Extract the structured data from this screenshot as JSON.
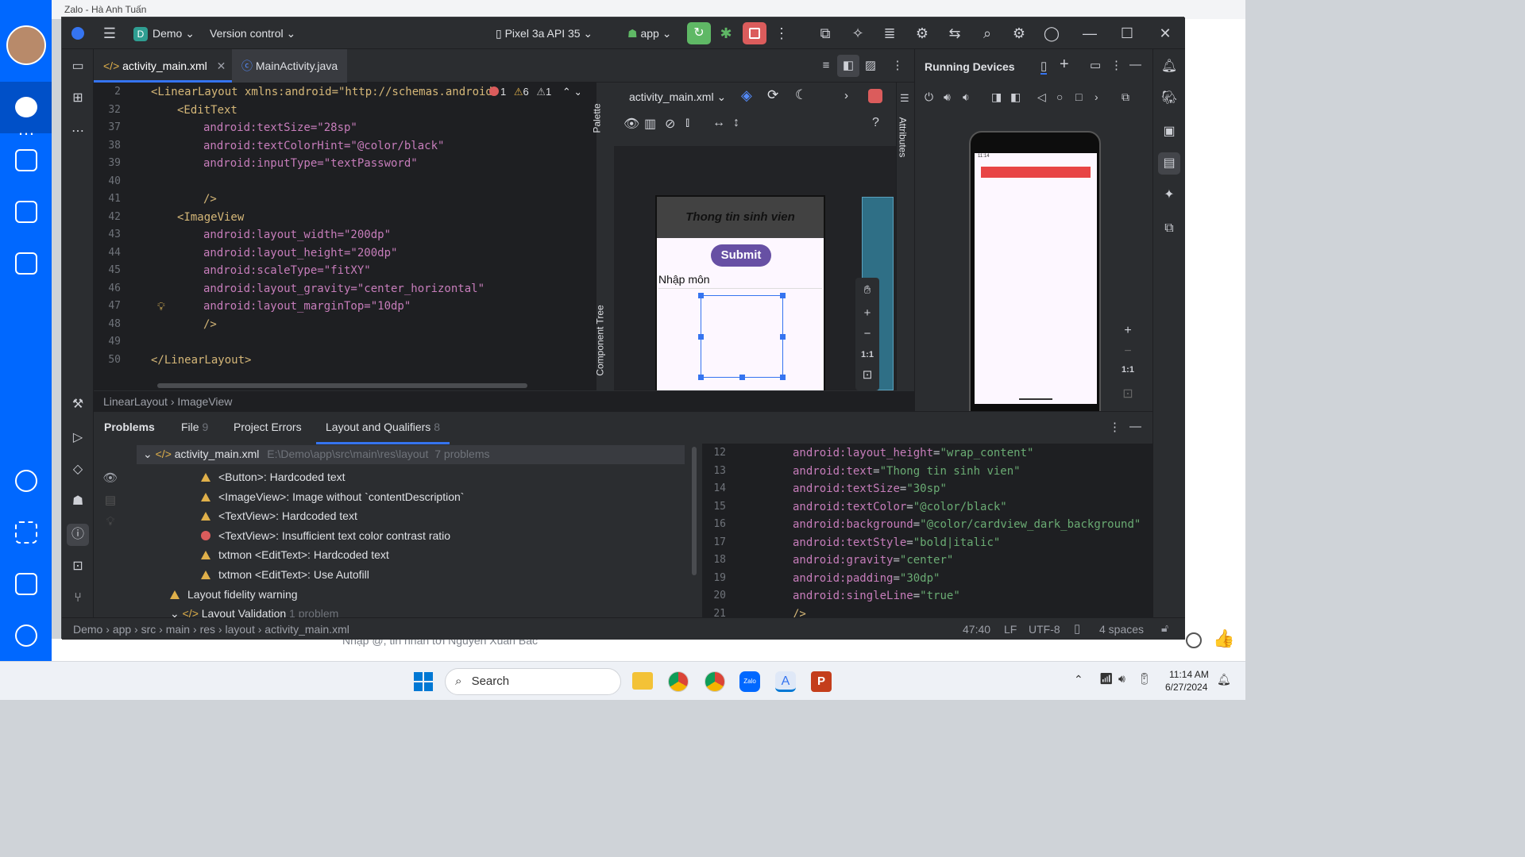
{
  "zalo": {
    "title": "Zalo - Hà Anh Tuấn",
    "chat_input_placeholder": "Nhập @, tin nhắn tới Nguyễn Xuân Bắc"
  },
  "toolbar": {
    "project": "Demo",
    "project_letter": "D",
    "version_control": "Version control",
    "device": "Pixel 3a API 35",
    "run_config": "app"
  },
  "editor_tabs": [
    {
      "label": "activity_main.xml"
    },
    {
      "label": "MainActivity.java"
    }
  ],
  "editor": {
    "lines": [
      {
        "n": "2",
        "text": "<LinearLayout xmlns:android=\"http://schemas.android"
      },
      {
        "n": "32",
        "text": "<EditText"
      },
      {
        "n": "37",
        "text": "android:textSize=\"28sp\""
      },
      {
        "n": "38",
        "text": "android:textColorHint=\"@color/black\""
      },
      {
        "n": "39",
        "text": "android:inputType=\"textPassword\""
      },
      {
        "n": "40",
        "text": ""
      },
      {
        "n": "41",
        "text": "/>"
      },
      {
        "n": "42",
        "text": "<ImageView"
      },
      {
        "n": "43",
        "text": "android:layout_width=\"200dp\""
      },
      {
        "n": "44",
        "text": "android:layout_height=\"200dp\""
      },
      {
        "n": "45",
        "text": "android:scaleType=\"fitXY\""
      },
      {
        "n": "46",
        "text": "android:layout_gravity=\"center_horizontal\""
      },
      {
        "n": "47",
        "text": "android:layout_marginTop=\"10dp\""
      },
      {
        "n": "48",
        "text": "/>"
      },
      {
        "n": "49",
        "text": ""
      },
      {
        "n": "50",
        "text": "</LinearLayout>"
      }
    ],
    "inspection": {
      "errors": "1",
      "warnings": "6",
      "weak": "1"
    }
  },
  "breadcrumb": {
    "parent": "LinearLayout",
    "child": "ImageView"
  },
  "design": {
    "file": "activity_main.xml",
    "palette": "Palette",
    "component_tree": "Component Tree",
    "attributes": "Attributes",
    "preview_title": "Thong tin sinh vien",
    "preview_button": "Submit",
    "preview_text": "Nhập môn",
    "zoom_reset": "1:1"
  },
  "running_devices": {
    "title": "Running Devices",
    "zoom_reset": "1:1"
  },
  "problems": {
    "title": "Problems",
    "tabs": [
      {
        "label": "File",
        "count": "9"
      },
      {
        "label": "Project Errors",
        "count": ""
      },
      {
        "label": "Layout and Qualifiers",
        "count": "8"
      }
    ],
    "file_node": {
      "name": "activity_main.xml",
      "path": "E:\\Demo\\app\\src\\main\\res\\layout",
      "count": "7 problems"
    },
    "items": [
      {
        "sev": "warn",
        "text": "<Button>: Hardcoded text"
      },
      {
        "sev": "warn",
        "text": "<ImageView>: Image without `contentDescription`"
      },
      {
        "sev": "warn",
        "text": "<TextView>: Hardcoded text"
      },
      {
        "sev": "error",
        "text": "<TextView>: Insufficient text color contrast ratio"
      },
      {
        "sev": "warn",
        "text": "txtmon <EditText>: Hardcoded text"
      },
      {
        "sev": "warn",
        "text": "txtmon <EditText>: Use Autofill"
      }
    ],
    "fidelity": "Layout fidelity warning",
    "validation": {
      "name": "Layout Validation",
      "count": "1 problem"
    },
    "preview_lines": [
      {
        "n": "12",
        "attr": "layout_height",
        "val": "\"wrap_content\""
      },
      {
        "n": "13",
        "attr": "text",
        "val": "\"Thong tin sinh vien\""
      },
      {
        "n": "14",
        "attr": "textSize",
        "val": "\"30sp\""
      },
      {
        "n": "15",
        "attr": "textColor",
        "val": "\"@color/black\""
      },
      {
        "n": "16",
        "attr": "background",
        "val": "\"@color/cardview_dark_background\""
      },
      {
        "n": "17",
        "attr": "textStyle",
        "val": "\"bold|italic\""
      },
      {
        "n": "18",
        "attr": "gravity",
        "val": "\"center\""
      },
      {
        "n": "19",
        "attr": "padding",
        "val": "\"30dp\""
      },
      {
        "n": "20",
        "attr": "singleLine",
        "val": "\"true\""
      },
      {
        "n": "21",
        "attr": "",
        "val": "/>"
      }
    ]
  },
  "statusbar": {
    "path": [
      "Demo",
      "app",
      "src",
      "main",
      "res",
      "layout",
      "activity_main.xml"
    ],
    "position": "47:40",
    "line_sep": "LF",
    "encoding": "UTF-8",
    "indent": "4 spaces"
  },
  "taskbar": {
    "search": "Search",
    "time": "11:14 AM",
    "date": "6/27/2024"
  },
  "colors": {
    "accent": "#3574f0",
    "run_green": "#5fb865",
    "stop_red": "#db5c5c",
    "zalo_blue": "#0068ff"
  }
}
